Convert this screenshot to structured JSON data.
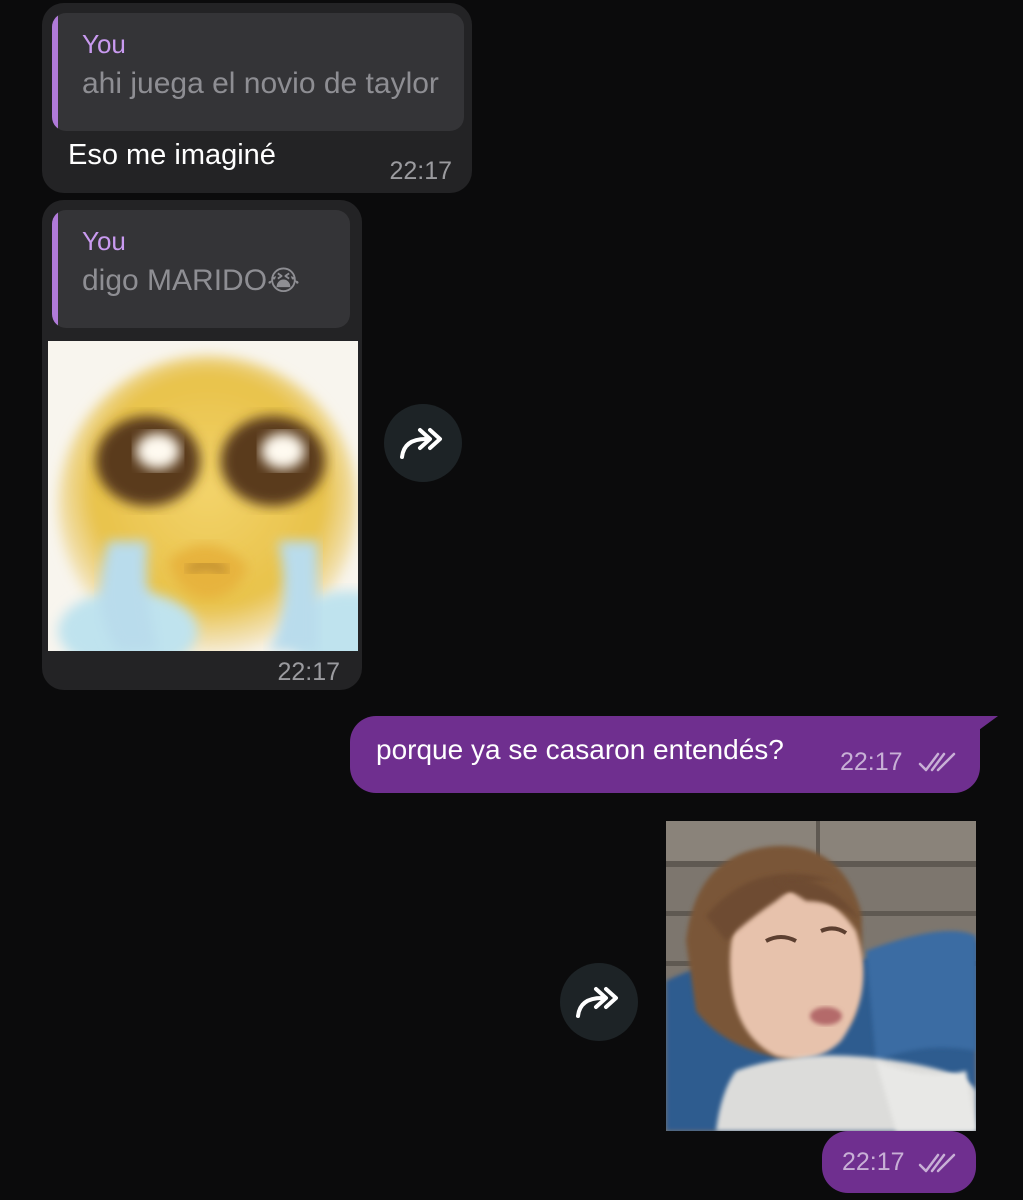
{
  "messages": [
    {
      "reply": {
        "author": "You",
        "text": "ahi juega el novio de taylor"
      },
      "text": "Eso me imaginé",
      "time": "22:17"
    },
    {
      "reply": {
        "author": "You",
        "text": "digo MARIDO"
      },
      "reply_emoji": "😭",
      "sticker": "crying-emoji-sticker",
      "time": "22:17"
    },
    {
      "text": "porque ya se casaron entendés?",
      "time": "22:17",
      "status": "read"
    },
    {
      "photo": "crying-woman-photo",
      "time": "22:17",
      "status": "read"
    }
  ],
  "icons": {
    "forward": "forward-arrows-icon",
    "read": "double-check-icon"
  },
  "colors": {
    "background": "#0b0b0c",
    "incoming_bubble": "#232325",
    "outgoing_bubble": "#6f2f8f",
    "reply_accent": "#b07ad9"
  }
}
